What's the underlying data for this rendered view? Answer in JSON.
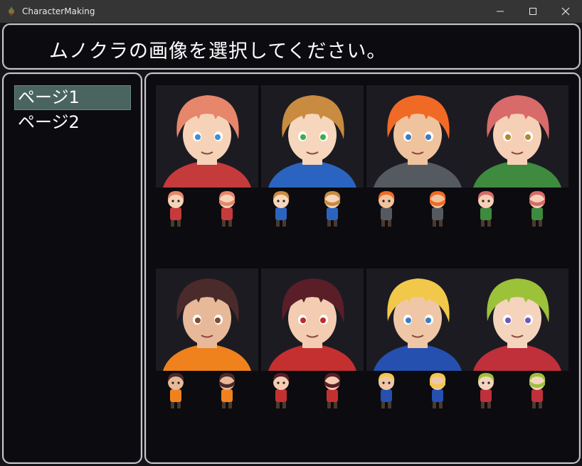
{
  "window": {
    "title": "CharacterMaking",
    "icons": [
      "app-icon",
      "minimize-icon",
      "maximize-icon",
      "close-icon"
    ]
  },
  "help": {
    "text": "ムノクラの画像を選択してください。"
  },
  "page_list": {
    "items": [
      {
        "label": "ページ1",
        "selected": true
      },
      {
        "label": "ページ2",
        "selected": false
      }
    ],
    "selection_color": "#4a6460"
  },
  "characters": [
    {
      "hair": "#e6866b",
      "skin": "#f6d3b8",
      "accent": "#c53a3a",
      "eyes": "#3c8fd6"
    },
    {
      "hair": "#c98b40",
      "skin": "#f6d6bc",
      "accent": "#2a64c0",
      "eyes": "#3cae4a"
    },
    {
      "hair": "#f06a26",
      "skin": "#efc39e",
      "accent": "#555a60",
      "eyes": "#3b7cc6"
    },
    {
      "hair": "#d86a6a",
      "skin": "#f6d0b6",
      "accent": "#3e8a3e",
      "eyes": "#b08a2e"
    },
    {
      "hair": "#4a2a2a",
      "skin": "#e8b999",
      "accent": "#f0821e",
      "eyes": "#7a4e30"
    },
    {
      "hair": "#5a1e28",
      "skin": "#f3ccb2",
      "accent": "#c43030",
      "eyes": "#c02a2a"
    },
    {
      "hair": "#f2c84a",
      "skin": "#efc7a6",
      "accent": "#2550b0",
      "eyes": "#3b7cc6"
    },
    {
      "hair": "#9cc23a",
      "skin": "#f4d4bc",
      "accent": "#c0303a",
      "eyes": "#6a5ab8"
    }
  ]
}
